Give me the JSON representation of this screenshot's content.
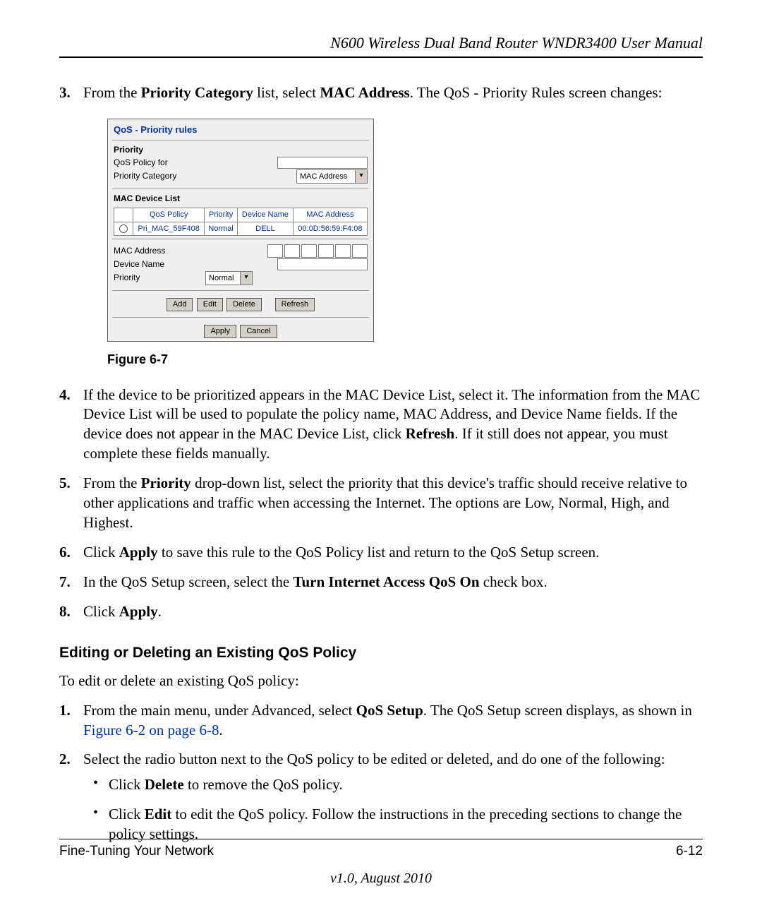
{
  "header": {
    "title": "N600 Wireless Dual Band Router WNDR3400 User Manual"
  },
  "steps": {
    "s3": {
      "num": "3.",
      "t1": "From the ",
      "b1": "Priority Category",
      "t2": " list, select ",
      "b2": "MAC Address",
      "t3": ". The QoS - Priority Rules screen changes:"
    },
    "s4": {
      "num": "4.",
      "t1": "If the device to be prioritized appears in the MAC Device List, select it. The information from the MAC Device List will be used to populate the policy name, MAC Address, and Device Name fields. If the device does not appear in the MAC Device List, click ",
      "b1": "Refresh",
      "t2": ". If it still does not appear, you must complete these fields manually."
    },
    "s5": {
      "num": "5.",
      "t1": "From the ",
      "b1": "Priority",
      "t2": " drop-down list, select the priority that this device's traffic should receive relative to other applications and traffic when accessing the Internet. The options are Low, Normal, High, and Highest."
    },
    "s6": {
      "num": "6.",
      "t1": "Click ",
      "b1": "Apply",
      "t2": " to save this rule to the QoS Policy list and return to the QoS Setup screen."
    },
    "s7": {
      "num": "7.",
      "t1": "In the QoS Setup screen, select the ",
      "b1": "Turn Internet Access QoS On",
      "t2": " check box."
    },
    "s8": {
      "num": "8.",
      "t1": "Click ",
      "b1": "Apply",
      "t2": "."
    }
  },
  "figure": {
    "caption": "Figure 6-7",
    "title": "QoS - Priority rules",
    "priority_label": "Priority",
    "qos_policy_for": "QoS Policy for",
    "priority_category_label": "Priority Category",
    "priority_category_value": "MAC Address",
    "mac_device_list_label": "MAC Device List",
    "table": {
      "h_policy": "QoS Policy",
      "h_priority": "Priority",
      "h_device": "Device Name",
      "h_mac": "MAC Address",
      "row": {
        "policy": "Pri_MAC_59F408",
        "priority": "Normal",
        "device": "DELL",
        "mac": "00:0D:56:59:F4:08"
      }
    },
    "mac_address_label": "MAC Address",
    "device_name_label": "Device Name",
    "priority_field_label": "Priority",
    "priority_value": "Normal",
    "btn_add": "Add",
    "btn_edit": "Edit",
    "btn_delete": "Delete",
    "btn_refresh": "Refresh",
    "btn_apply": "Apply",
    "btn_cancel": "Cancel"
  },
  "section": {
    "heading": "Editing or Deleting an Existing QoS Policy",
    "intro": "To edit or delete an existing QoS policy:",
    "e1": {
      "num": "1.",
      "t1": "From the main menu, under Advanced, select ",
      "b1": "QoS Setup",
      "t2": ". The QoS Setup screen displays, as shown in ",
      "link": "Figure 6-2 on page 6-8",
      "t3": "."
    },
    "e2": {
      "num": "2.",
      "t1": "Select the radio button next to the QoS policy to be edited or deleted, and do one of the following:"
    },
    "bullets": {
      "b1": {
        "t1": "Click ",
        "b": "Delete",
        "t2": " to remove the QoS policy."
      },
      "b2": {
        "t1": "Click ",
        "b": "Edit",
        "t2": " to edit the QoS policy. Follow the instructions in the preceding sections to change the policy settings."
      }
    }
  },
  "footer": {
    "left": "Fine-Tuning Your Network",
    "right": "6-12",
    "version": "v1.0, August 2010"
  }
}
